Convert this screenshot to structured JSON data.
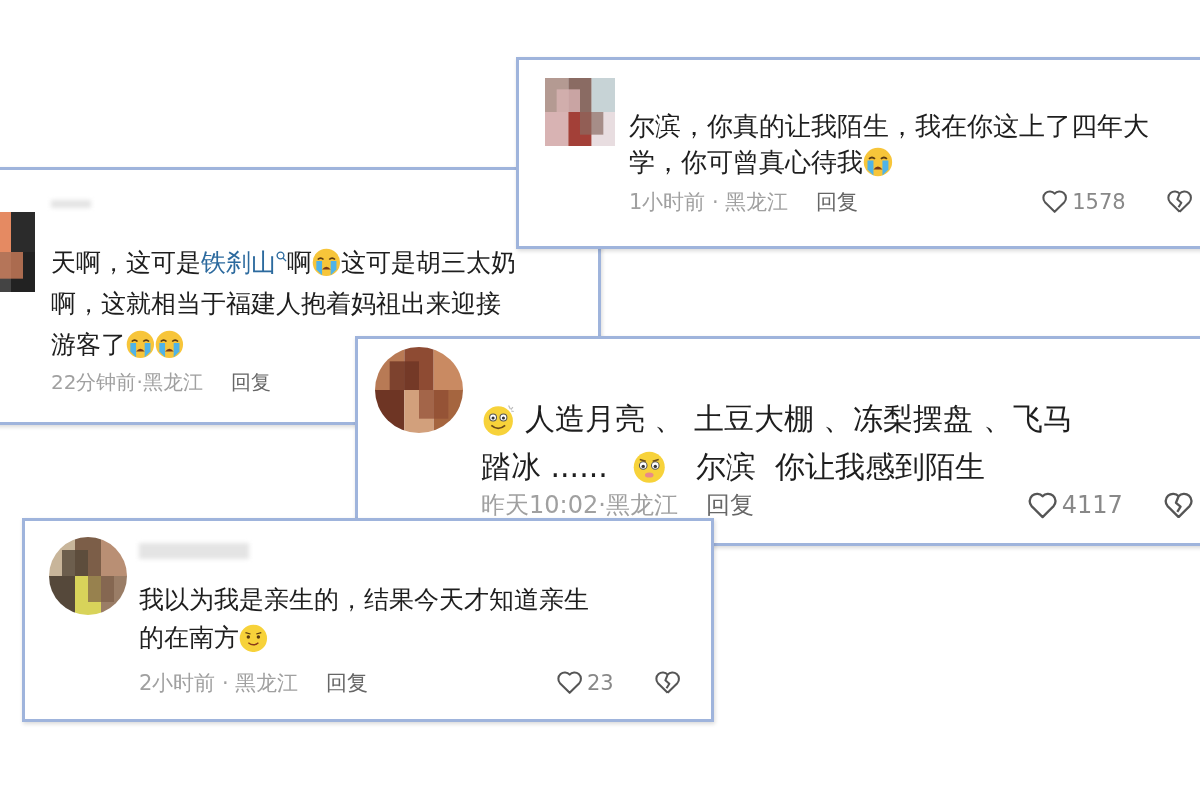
{
  "comments": [
    {
      "blurred_name": false,
      "lines": [
        [
          {
            "kind": "text",
            "value": "尔滨，你真的让我陌生，我在你这上了四年大"
          }
        ],
        [
          {
            "kind": "text",
            "value": "学，你可曾真心待我"
          },
          {
            "kind": "crying"
          }
        ]
      ],
      "time": "1小时前 · 黑龙江",
      "reply": "回复",
      "likes": "1578"
    },
    {
      "blurred_name": true,
      "lines": [
        [
          {
            "kind": "text",
            "value": "天啊，这可是"
          },
          {
            "kind": "link",
            "value": "铁刹山"
          },
          {
            "kind": "text",
            "value": "啊"
          },
          {
            "kind": "crying"
          },
          {
            "kind": "text",
            "value": "这可是胡三太奶"
          }
        ],
        [
          {
            "kind": "text",
            "value": "啊，这就相当于福建人抱着妈祖出来迎接"
          }
        ],
        [
          {
            "kind": "text",
            "value": "游客了"
          },
          {
            "kind": "crying"
          },
          {
            "kind": "crying"
          }
        ]
      ],
      "time": "22分钟前·黑龙江",
      "reply": "回复"
    },
    {
      "blurred_name": false,
      "lines": [
        [
          {
            "kind": "grin"
          },
          {
            "kind": "text",
            "value": "人造月亮 、 土豆大棚 、冻梨摆盘 、飞马"
          }
        ],
        [
          {
            "kind": "text",
            "value": "踏冰 ......"
          },
          {
            "kind": "teary"
          },
          {
            "kind": "text",
            "value": "尔滨  你让我感到陌生"
          }
        ]
      ],
      "time": "昨天10:02·黑龙江",
      "reply": "回复",
      "likes": "4117"
    },
    {
      "blurred_name": true,
      "lines": [
        [
          {
            "kind": "text",
            "value": "我以为我是亲生的，结果今天才知道亲生"
          }
        ],
        [
          {
            "kind": "text",
            "value": "的在南方"
          },
          {
            "kind": "smirk"
          }
        ]
      ],
      "time": "2小时前 · 黑龙江",
      "reply": "回复",
      "likes": "23"
    }
  ]
}
